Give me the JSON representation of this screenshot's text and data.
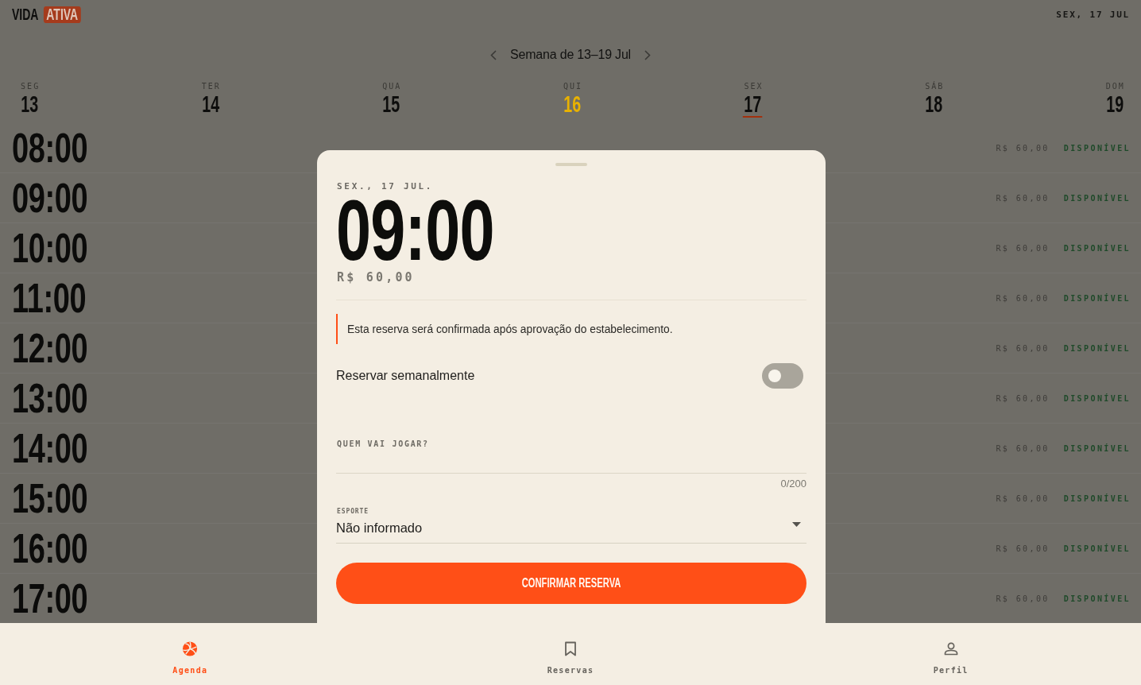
{
  "header": {
    "logo": {
      "text": "VIDA",
      "badge": "ATIVA"
    },
    "date": "SEX, 17 JUL"
  },
  "week_nav": {
    "label": "Semana de 13–19 Jul"
  },
  "days": [
    {
      "weekday": "SEG",
      "date": "13",
      "selected": false,
      "today": false
    },
    {
      "weekday": "TER",
      "date": "14",
      "selected": false,
      "today": false
    },
    {
      "weekday": "QUA",
      "date": "15",
      "selected": false,
      "today": false
    },
    {
      "weekday": "QUI",
      "date": "16",
      "selected": false,
      "today": true
    },
    {
      "weekday": "SEX",
      "date": "17",
      "selected": true,
      "today": false
    },
    {
      "weekday": "SÁB",
      "date": "18",
      "selected": false,
      "today": false
    },
    {
      "weekday": "DOM",
      "date": "19",
      "selected": false,
      "today": false
    }
  ],
  "slots": [
    {
      "time": "08:00",
      "price": "R$ 60,00",
      "status": "DISPONÍVEL"
    },
    {
      "time": "09:00",
      "price": "R$ 60,00",
      "status": "DISPONÍVEL"
    },
    {
      "time": "10:00",
      "price": "R$ 60,00",
      "status": "DISPONÍVEL"
    },
    {
      "time": "11:00",
      "price": "R$ 60,00",
      "status": "DISPONÍVEL"
    },
    {
      "time": "12:00",
      "price": "R$ 60,00",
      "status": "DISPONÍVEL"
    },
    {
      "time": "13:00",
      "price": "R$ 60,00",
      "status": "DISPONÍVEL"
    },
    {
      "time": "14:00",
      "price": "R$ 60,00",
      "status": "DISPONÍVEL"
    },
    {
      "time": "15:00",
      "price": "R$ 60,00",
      "status": "DISPONÍVEL"
    },
    {
      "time": "16:00",
      "price": "R$ 60,00",
      "status": "DISPONÍVEL"
    },
    {
      "time": "17:00",
      "price": "R$ 60,00",
      "status": "DISPONÍVEL"
    }
  ],
  "booking_sheet": {
    "date": "SEX., 17 JUL.",
    "time": "09:00",
    "price": "R$ 60,00",
    "notice": "Esta reserva será confirmada após aprovação do estabelecimento.",
    "weekly": {
      "label": "Reservar semanalmente",
      "on": false
    },
    "players": {
      "label": "QUEM VAI JOGAR?",
      "counter": "0/200"
    },
    "sport": {
      "label": "ESPORTE",
      "value": "Não informado"
    },
    "confirm_button": "CONFIRMAR RESERVA"
  },
  "bottom_nav": [
    {
      "label": "Agenda",
      "selected": true
    },
    {
      "label": "Reservas",
      "selected": false
    },
    {
      "label": "Perfil",
      "selected": false
    }
  ]
}
